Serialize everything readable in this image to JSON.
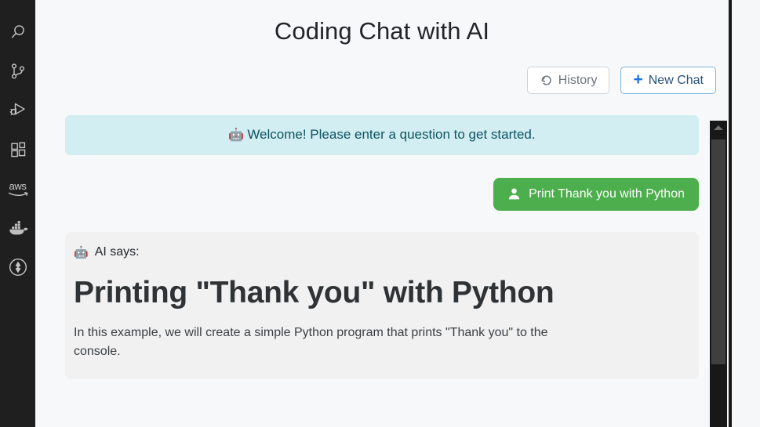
{
  "activity_bar": {
    "background": "#1f1f1f",
    "items": [
      {
        "name": "search-icon",
        "label": "Search"
      },
      {
        "name": "source-control-icon",
        "label": "Source Control"
      },
      {
        "name": "run-and-debug-icon",
        "label": "Run and Debug"
      },
      {
        "name": "extensions-icon",
        "label": "Extensions"
      },
      {
        "name": "aws-toolkit-icon",
        "label": "aws"
      },
      {
        "name": "docker-icon",
        "label": "Docker"
      },
      {
        "name": "compass-circle-icon",
        "label": "Gitpod"
      }
    ]
  },
  "header": {
    "title": "Coding Chat with AI"
  },
  "toolbar": {
    "history_label": "History",
    "history_icon": "history-rewind-icon",
    "new_chat_label": "New Chat",
    "new_chat_icon": "plus-icon",
    "new_chat_accent": "#1a73e8"
  },
  "chat": {
    "welcome": {
      "icon": "robot-icon",
      "emoji": "🤖",
      "text": "Welcome! Please enter a question to get started.",
      "background": "#d3eef2",
      "text_color": "#0c5460"
    },
    "user_message": {
      "icon": "user-icon",
      "text": "Print Thank you with Python",
      "background": "#4cae4c",
      "text_color": "#ffffff"
    },
    "ai_message": {
      "icon": "robot-icon",
      "emoji": "🤖",
      "label": "AI says:",
      "heading": "Printing \"Thank you\" with Python",
      "paragraph": "In this example, we will create a simple Python program that prints \"Thank you\" to the console.",
      "background": "#f1f1f1"
    }
  },
  "scrollbar": {
    "orientation": "vertical",
    "up_arrow_icon": "chevron-up-icon",
    "track_color": "#181818",
    "thumb_color": "#3f3f3f"
  }
}
